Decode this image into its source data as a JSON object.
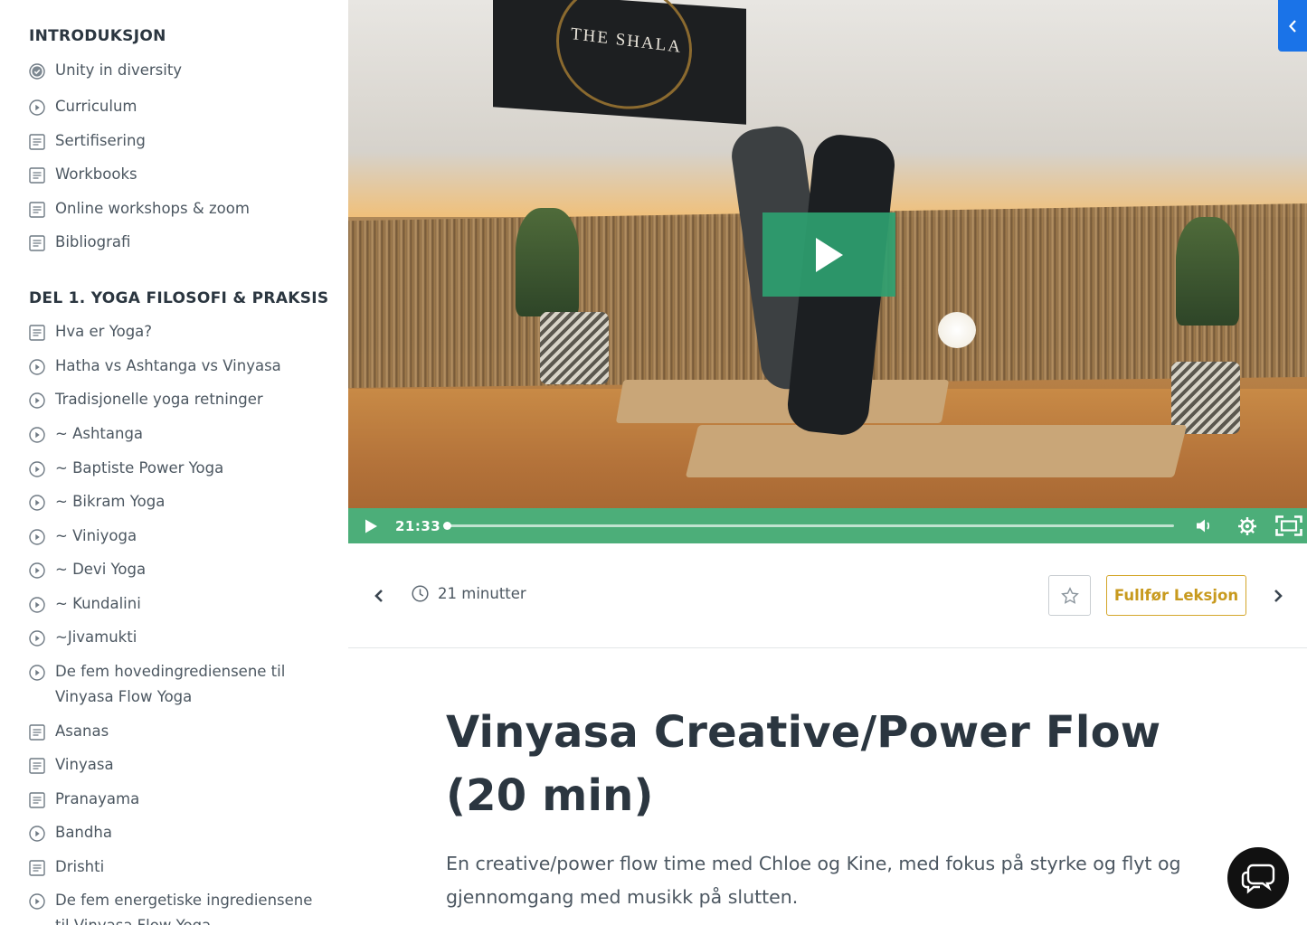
{
  "sidebar": {
    "sections": [
      {
        "title": "INTRODUKSJON",
        "items": [
          {
            "label": "Unity in diversity",
            "icon": "check-circle-icon"
          },
          {
            "label": "Curriculum",
            "icon": "play-circle-icon"
          },
          {
            "label": "Sertifisering",
            "icon": "document-icon"
          },
          {
            "label": "Workbooks",
            "icon": "document-icon"
          },
          {
            "label": "Online workshops & zoom",
            "icon": "document-icon"
          },
          {
            "label": "Bibliografi",
            "icon": "document-icon"
          }
        ]
      },
      {
        "title": "DEL 1. YOGA FILOSOFI & PRAKSIS",
        "items": [
          {
            "label": "Hva er Yoga?",
            "icon": "document-icon"
          },
          {
            "label": "Hatha vs Ashtanga vs Vinyasa",
            "icon": "play-circle-icon"
          },
          {
            "label": "Tradisjonelle yoga retninger",
            "icon": "play-circle-icon"
          },
          {
            "label": "~ Ashtanga",
            "icon": "play-circle-icon"
          },
          {
            "label": "~ Baptiste Power Yoga",
            "icon": "play-circle-icon"
          },
          {
            "label": "~ Bikram Yoga",
            "icon": "play-circle-icon"
          },
          {
            "label": "~ Viniyoga",
            "icon": "play-circle-icon"
          },
          {
            "label": "~ Devi Yoga",
            "icon": "play-circle-icon"
          },
          {
            "label": "~ Kundalini",
            "icon": "play-circle-icon"
          },
          {
            "label": "~Jivamukti",
            "icon": "play-circle-icon"
          },
          {
            "label": "De fem hovedingrediensene til Vinyasa Flow Yoga",
            "icon": "play-circle-icon"
          },
          {
            "label": "Asanas",
            "icon": "document-icon"
          },
          {
            "label": "Vinyasa",
            "icon": "document-icon"
          },
          {
            "label": "Pranayama",
            "icon": "document-icon"
          },
          {
            "label": "Bandha",
            "icon": "play-circle-icon"
          },
          {
            "label": "Drishti",
            "icon": "document-icon"
          },
          {
            "label": "De fem energetiske ingrediensene til Vinyasa Flow Yoga",
            "icon": "play-circle-icon"
          }
        ]
      }
    ]
  },
  "video": {
    "banner_text": "THE SHALA",
    "time": "21:33",
    "progress": 0.0,
    "accent": "#4cae79"
  },
  "lesson": {
    "duration": "21 minutter",
    "complete_label": "Fullfør Leksjon",
    "title": "Vinyasa Creative/Power Flow (20 min)",
    "description": "En creative/power flow time med Chloe og Kine, med fokus på styrke og flyt og gjennomgang med musikk på slutten."
  },
  "colors": {
    "accent_gold": "#c89a1e",
    "toggle_blue": "#1a73e8"
  }
}
